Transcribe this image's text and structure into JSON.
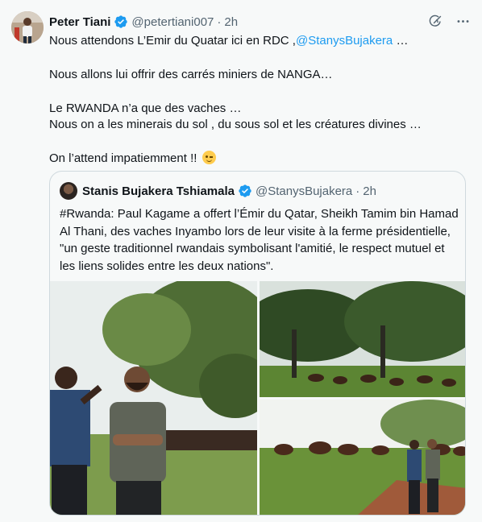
{
  "post": {
    "author_name": "Peter Tiani",
    "handle": "@petertiani007",
    "separator": "·",
    "time": "2h",
    "lines": {
      "l1_prefix": "Nous attendons L’Emir du Quatar ici en RDC ,",
      "l1_mention": "@StanysBujakera",
      "l1_suffix": " …",
      "l2": "Nous allons lui offrir des carrés miniers de NANGA…",
      "l3": "Le RWANDA n’a que des vaches …",
      "l4": "Nous on a les minerais du sol , du sous sol et les créatures divines …",
      "l5": "On l’attend impatiemment !! "
    },
    "emoji_icon": "winking-face-emoji"
  },
  "quote": {
    "author_name": "Stanis Bujakera Tshiamala",
    "handle": "@StanysBujakera",
    "separator": "·",
    "time": "2h",
    "text": "#Rwanda: Paul Kagame a offert l’Émir du Qatar, Sheikh Tamim bin Hamad Al Thani, des vaches Inyambo lors de leur visite à la ferme présidentielle, \"un geste traditionnel rwandais symbolisant l'amitié, le respect mutuel et les liens solides entre les deux nations\".",
    "media": [
      {
        "alt_icon": "photo-two-men-standing-outdoors"
      },
      {
        "alt_icon": "photo-cattle-grazing-under-trees"
      },
      {
        "alt_icon": "photo-men-with-cattle-in-field"
      }
    ]
  },
  "icons": {
    "verified": "verified-badge-icon",
    "grok": "grok-icon",
    "more": "more-icon"
  },
  "colors": {
    "accent": "#1d9bf0",
    "text": "#0f1419",
    "muted": "#536471",
    "background": "#f7f9f9"
  }
}
